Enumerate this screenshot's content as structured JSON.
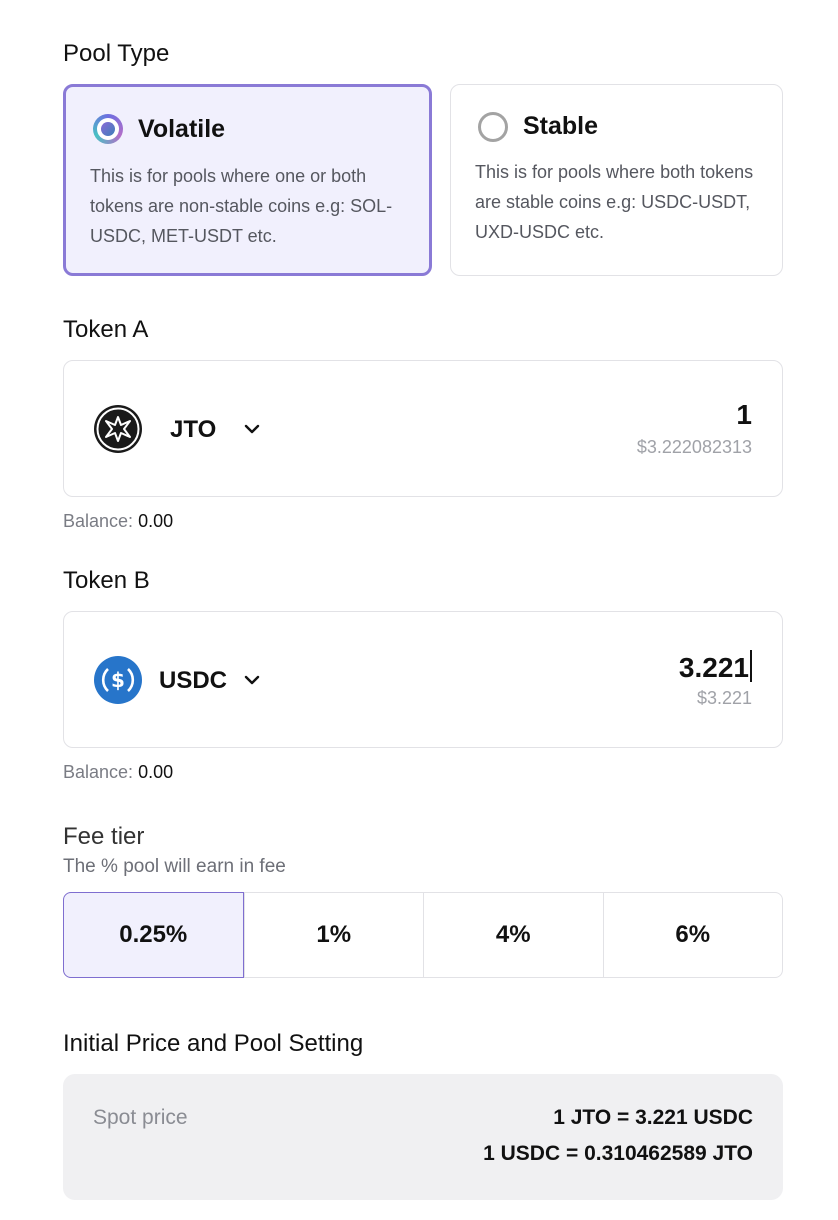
{
  "pool_type": {
    "title": "Pool Type",
    "options": [
      {
        "name": "Volatile",
        "description": "This is for pools where one or both tokens are non-stable coins e.g: SOL-USDC, MET-USDT etc.",
        "selected": true
      },
      {
        "name": "Stable",
        "description": "This is for pools where both tokens are stable coins e.g: USDC-USDT, UXD-USDC etc.",
        "selected": false
      }
    ]
  },
  "token_a": {
    "title": "Token A",
    "symbol": "JTO",
    "icon": "jto-token-icon",
    "amount": "1",
    "usd_value": "$3.222082313",
    "balance_label": "Balance:",
    "balance_value": "0.00"
  },
  "token_b": {
    "title": "Token B",
    "symbol": "USDC",
    "icon": "usdc-token-icon",
    "amount": "3.221",
    "usd_value": "$3.221",
    "balance_label": "Balance:",
    "balance_value": "0.00"
  },
  "fee_tier": {
    "title": "Fee tier",
    "subtitle": "The % pool will earn in fee",
    "options": [
      "0.25%",
      "1%",
      "4%",
      "6%"
    ],
    "selected": "0.25%"
  },
  "initial_price": {
    "title": "Initial Price and Pool Setting",
    "spot_label": "Spot price",
    "spot_line_1": "1 JTO = 3.221 USDC",
    "spot_line_2": "1 USDC = 0.310462589 JTO"
  },
  "colors": {
    "accent": "#8a7ad6",
    "selected_bg": "#f1f0fd",
    "usdc_blue": "#2775ca",
    "jto_dark": "#1a1a1a"
  }
}
